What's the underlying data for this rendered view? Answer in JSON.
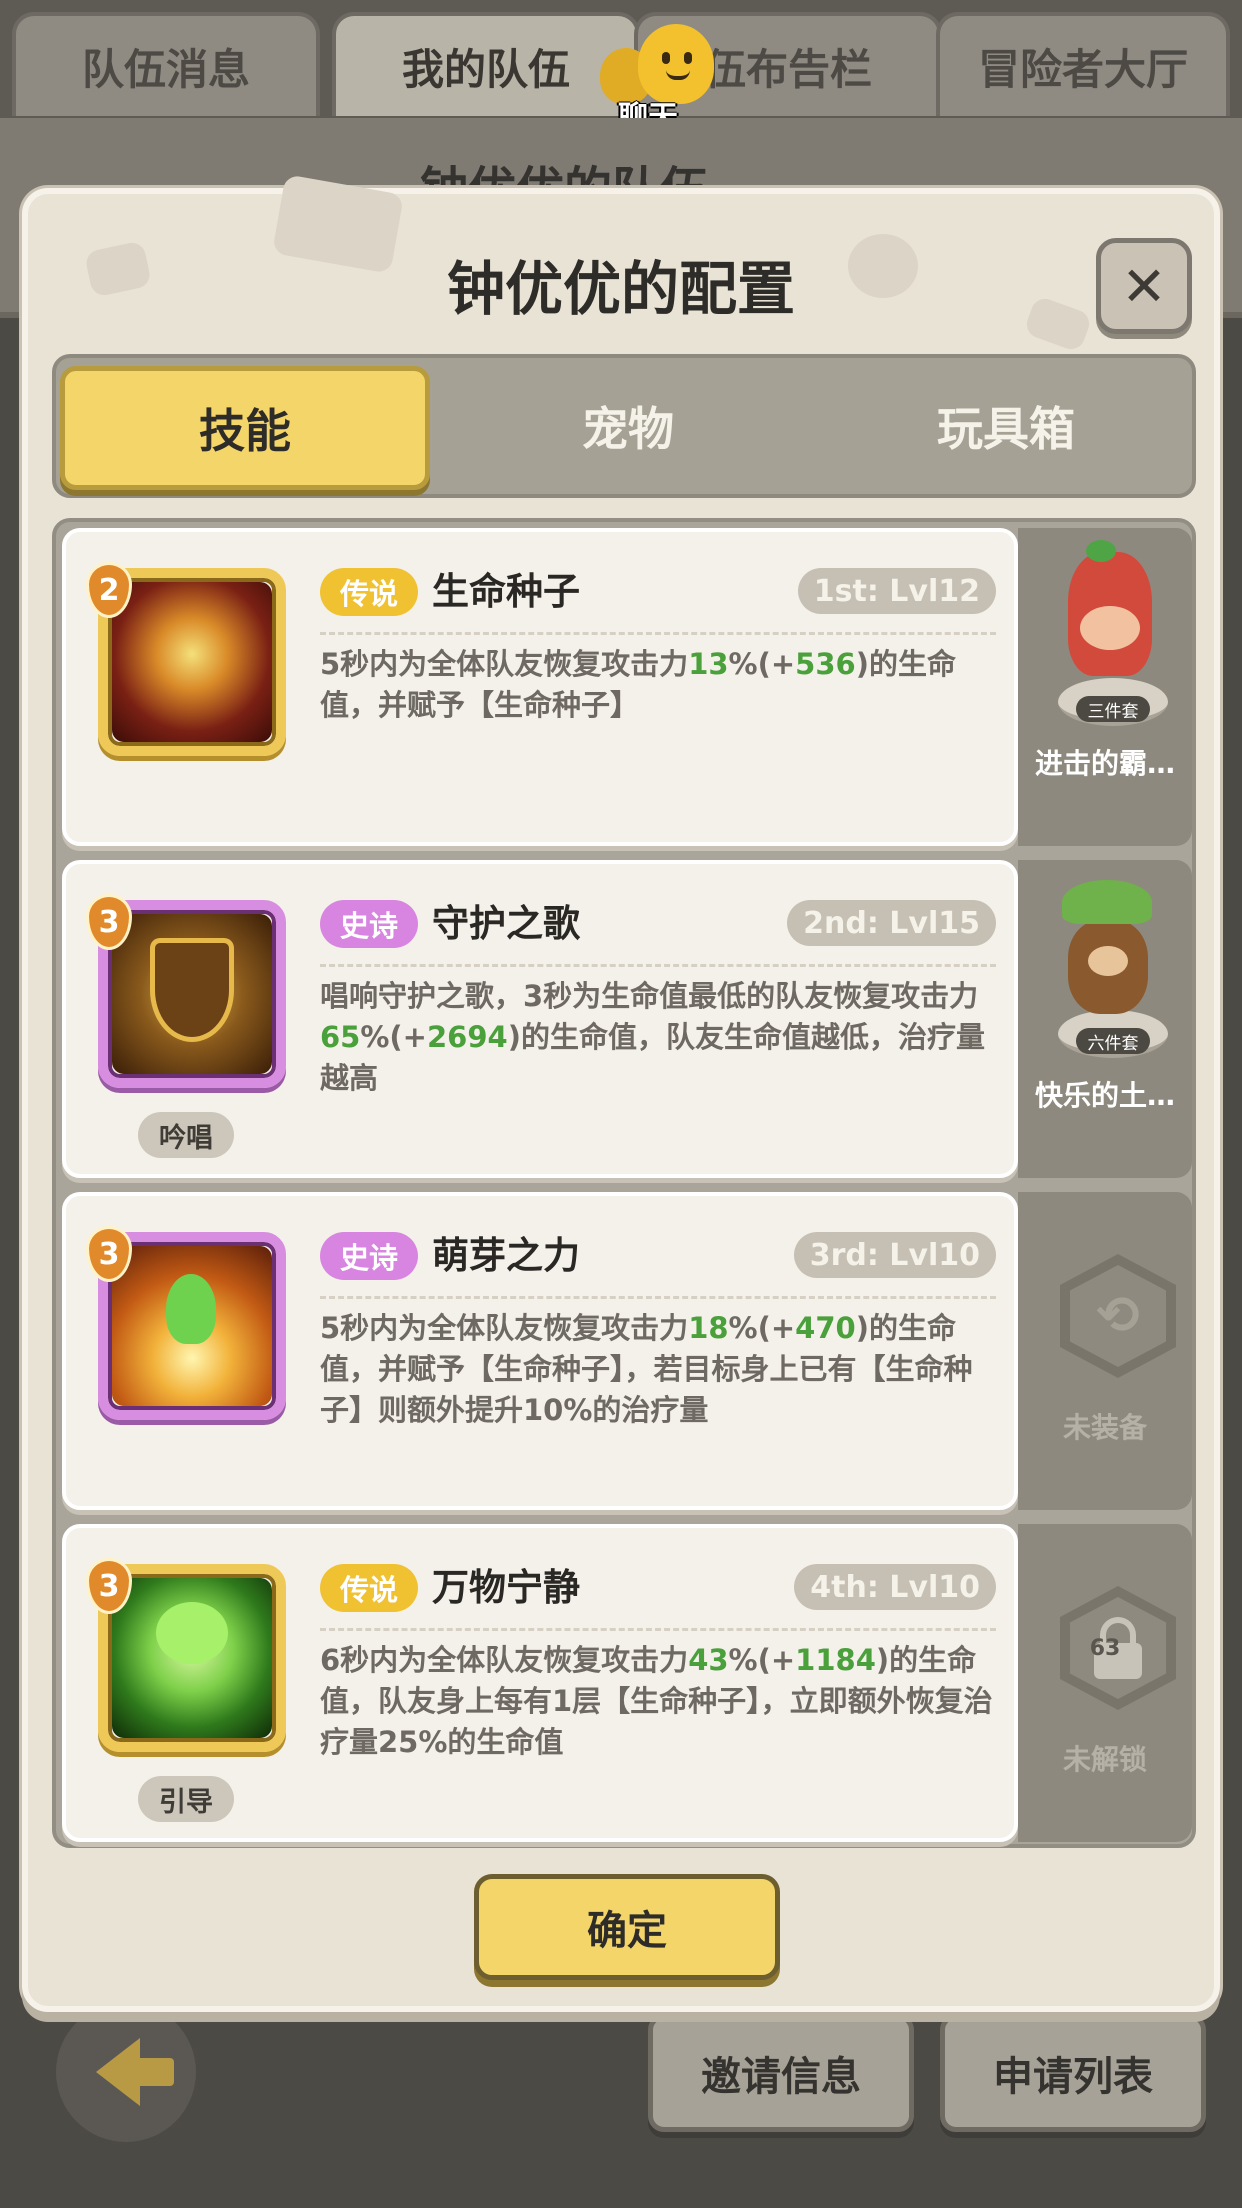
{
  "top_tabs": [
    "队伍消息",
    "我的队伍",
    "伍布告栏",
    "冒险者大厅"
  ],
  "active_top_tab": "我的队伍",
  "chat_label": "聊天",
  "background_title": "钟优优的队伍",
  "modal": {
    "title": "钟优优的配置",
    "close_icon": "close-icon",
    "tabs": [
      "技能",
      "宠物",
      "玩具箱"
    ],
    "active_tab": "技能",
    "confirm_label": "确定"
  },
  "skills": [
    {
      "badge": "2",
      "rarity": "传说",
      "name": "生命种子",
      "slot": "1st: Lvl12",
      "cast_tag": "",
      "desc_parts": [
        "5秒内为全体队友恢复攻击力",
        "13",
        "%(+",
        "536",
        ")的生命值，并赋予【生命种子】"
      ],
      "side_label": "进击的霸…",
      "side_badge": "三件套"
    },
    {
      "badge": "3",
      "rarity": "史诗",
      "name": "守护之歌",
      "slot": "2nd: Lvl15",
      "cast_tag": "吟唱",
      "desc_parts": [
        "唱响守护之歌，3秒为生命值最低的队友恢复攻击力",
        "65",
        "%(+",
        "2694",
        ")的生命值，队友生命值越低，治疗量越高"
      ],
      "side_label": "快乐的土…",
      "side_badge": "六件套"
    },
    {
      "badge": "3",
      "rarity": "史诗",
      "name": "萌芽之力",
      "slot": "3rd: Lvl10",
      "cast_tag": "",
      "desc_parts": [
        "5秒内为全体队友恢复攻击力",
        "18",
        "%(+",
        "470",
        ")的生命值，并赋予【生命种子】，若目标身上已有【生命种子】则额外提升10%的治疗量"
      ],
      "side_label": "未装备",
      "side_badge": ""
    },
    {
      "badge": "3",
      "rarity": "传说",
      "name": "万物宁静",
      "slot": "4th: Lvl10",
      "cast_tag": "引导",
      "desc_parts": [
        "6秒内为全体队友恢复攻击力",
        "43",
        "%(+",
        "1184",
        ")的生命值，队友身上每有1层【生命种子】，立即额外恢复治疗量25%的生命值"
      ],
      "side_label": "未解锁",
      "side_badge": "63"
    }
  ],
  "bottom_buttons": [
    "邀请信息",
    "申请列表"
  ],
  "colors": {
    "legend": "#f0c232",
    "epic": "#d785e0",
    "highlight_green": "#4aa03a",
    "primary_button": "#f4d56a"
  }
}
